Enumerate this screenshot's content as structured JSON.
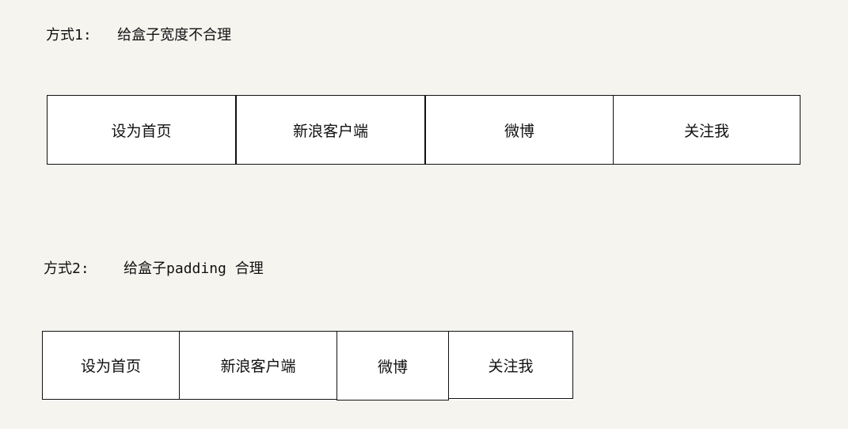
{
  "section1": {
    "heading": "方式1:   给盒子宽度不合理",
    "items": [
      "设为首页",
      "新浪客户端",
      "微博",
      "关注我"
    ]
  },
  "section2": {
    "heading": "方式2:    给盒子padding 合理",
    "items": [
      "设为首页",
      "新浪客户端",
      "微博",
      "关注我"
    ]
  }
}
